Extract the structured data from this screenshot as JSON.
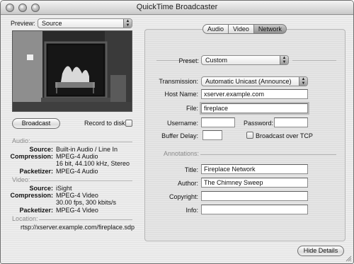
{
  "window": {
    "title": "QuickTime Broadcaster"
  },
  "left": {
    "preview_label": "Preview:",
    "preview_value": "Source",
    "broadcast_button": "Broadcast",
    "record_to_disk": "Record to disk",
    "audio_section": "Audio:",
    "audio": {
      "source_label": "Source:",
      "source_value": "Built-in Audio / Line In",
      "compression_label": "Compression:",
      "compression_value": "MPEG-4 Audio",
      "compression_detail": "16 bit, 44.100 kHz, Stereo",
      "packetizer_label": "Packetizer:",
      "packetizer_value": "MPEG-4 Audio"
    },
    "video_section": "Video:",
    "video": {
      "source_label": "Source:",
      "source_value": "iSight",
      "compression_label": "Compression:",
      "compression_value": "MPEG-4 Video",
      "compression_detail": "30.00 fps, 300 kbits/s",
      "packetizer_label": "Packetizer:",
      "packetizer_value": "MPEG-4 Video"
    },
    "location_section": "Location:",
    "location_url": "rtsp://xserver.example.com/fireplace.sdp"
  },
  "tabs": {
    "audio": "Audio",
    "video": "Video",
    "network": "Network",
    "selected": "Network"
  },
  "network": {
    "preset_label": "Preset:",
    "preset_value": "Custom",
    "transmission_label": "Transmission:",
    "transmission_value": "Automatic Unicast (Announce)",
    "host_label": "Host Name:",
    "host_value": "xserver.example.com",
    "file_label": "File:",
    "file_value": "fireplace",
    "username_label": "Username:",
    "username_value": "",
    "password_label": "Password:",
    "password_value": "",
    "buffer_label": "Buffer Delay:",
    "buffer_value": "",
    "broadcast_tcp": "Broadcast over TCP"
  },
  "annotations": {
    "section": "Annotations:",
    "title_label": "Title:",
    "title_value": "Fireplace Network",
    "author_label": "Author:",
    "author_value": "The Chimney Sweep",
    "copyright_label": "Copyright:",
    "copyright_value": "",
    "info_label": "Info:",
    "info_value": ""
  },
  "hide_details_button": "Hide Details"
}
